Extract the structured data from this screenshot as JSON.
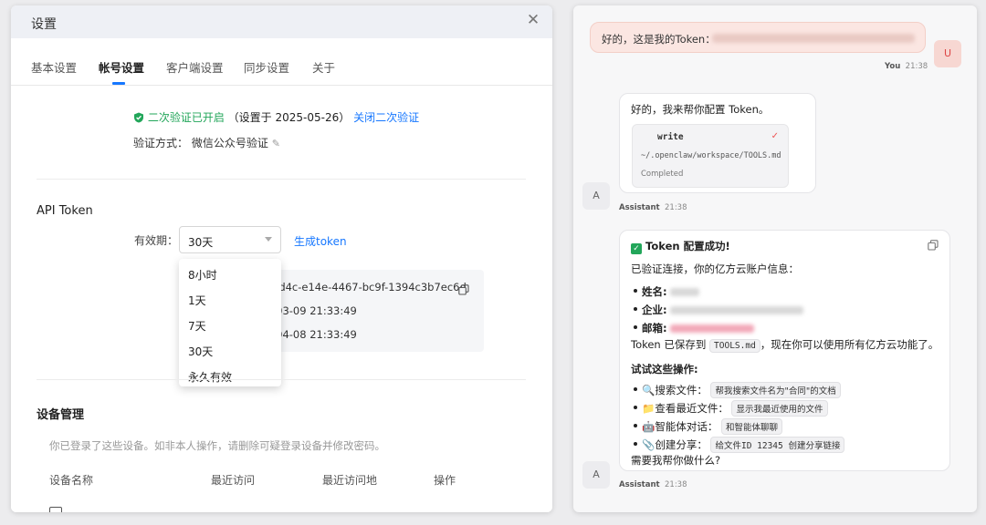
{
  "settings": {
    "title": "设置",
    "tabs": [
      "基本设置",
      "帐号设置",
      "客户端设置",
      "同步设置",
      "关于"
    ],
    "tfa_status": "二次验证已开启",
    "tfa_set_date": "（设置于 2025-05-26）",
    "tfa_disable": "关闭二次验证",
    "verify_label": "验证方式：",
    "verify_value": "微信公众号验证",
    "api_title": "API Token",
    "expiry_label": "有效期：",
    "expiry_value": "30天",
    "generate": "生成token",
    "expiry_options": [
      "8小时",
      "1天",
      "7天",
      "30天",
      "永久有效"
    ],
    "token_value": "3d4c-e14e-4467-bc9f-1394c3b7ec6d",
    "token_created": "-03-09 21:33:49",
    "token_expires": "-04-08 21:33:49",
    "devices_title": "设备管理",
    "devices_desc": "你已登录了这些设备。如非本人操作，请删除可疑登录设备并修改密码。",
    "columns": [
      "设备名称",
      "最近访问",
      "最近访问地",
      "操作"
    ]
  },
  "chat": {
    "user_message": "好的，这是我的Token：",
    "user_avatar": "U",
    "user_name": "You",
    "user_time": "21:38",
    "assistant_avatar": "A",
    "assistant_name": "Assistant",
    "msg1_time": "21:38",
    "msg1_text": "好的，我来帮你配置 Token。",
    "tool_name": "write",
    "tool_path": "~/.openclaw/workspace/TOOLS.md",
    "tool_status": "Completed",
    "msg2_time": "21:38",
    "success_title": "Token 配置成功!",
    "verified_line": "已验证连接，你的亿方云账户信息：",
    "field_name": "姓名:",
    "field_company": "企业:",
    "field_email": "邮箱:",
    "saved_pre": "Token 已保存到",
    "saved_file": "TOOLS.md",
    "saved_post": "，现在你可以使用所有亿方云功能了。",
    "try_title": "试试这些操作:",
    "ops": [
      {
        "icon": "🔍",
        "label": "搜索文件：",
        "example": "帮我搜索文件名为\"合同\"的文档"
      },
      {
        "icon": "📁",
        "label": "查看最近文件：",
        "example": "显示我最近使用的文件"
      },
      {
        "icon": "🤖",
        "label": "智能体对话：",
        "example": "和智能体聊聊"
      },
      {
        "icon": "📎",
        "label": "创建分享：",
        "example": "给文件ID 12345 创建分享链接"
      }
    ],
    "closing": "需要我帮你做什么?"
  },
  "colors": {
    "accent": "#1677ff",
    "success": "#22a65a",
    "user_bubble": "#fbe6e2"
  }
}
